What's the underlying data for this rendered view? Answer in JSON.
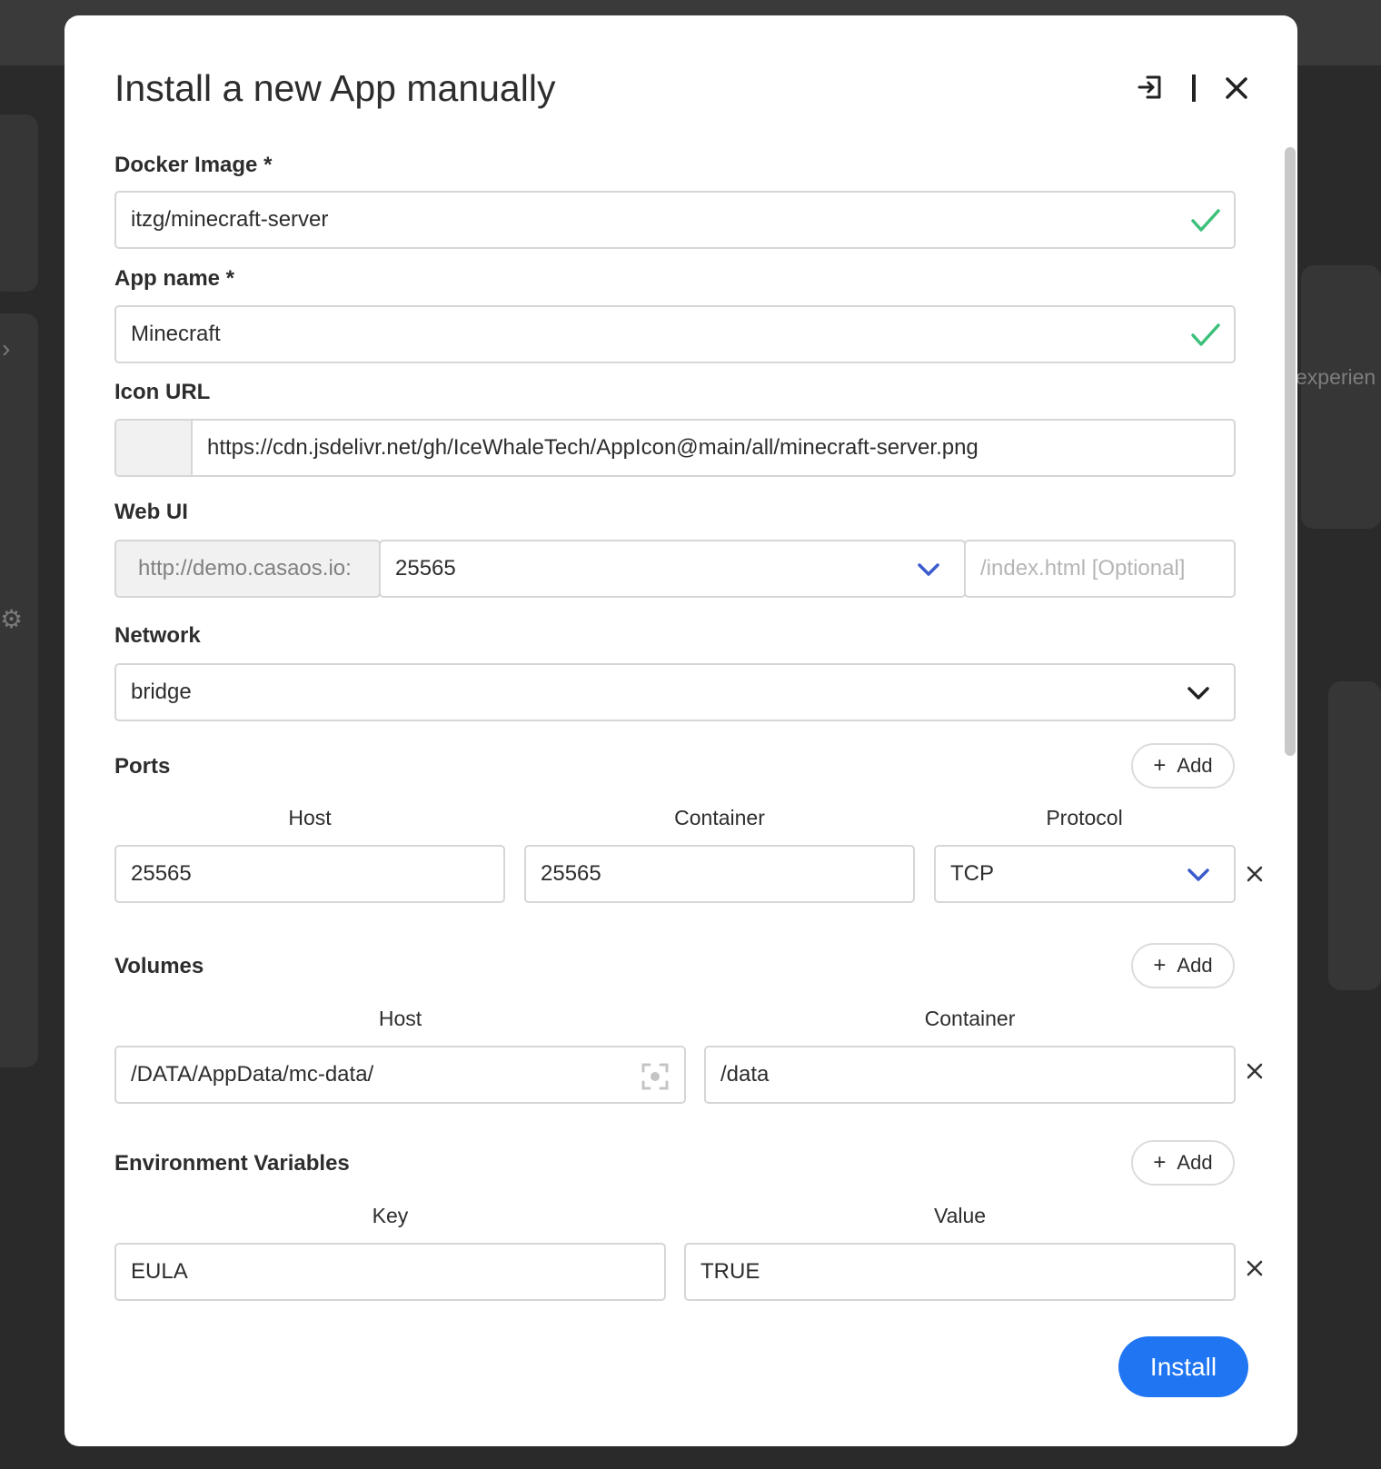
{
  "dialog": {
    "title": "Install a new App manually",
    "icons": {
      "import": "import-icon",
      "close": "close-icon"
    }
  },
  "docker_image": {
    "label": "Docker Image *",
    "value": "itzg/minecraft-server",
    "status_icon": "check-icon"
  },
  "app_name": {
    "label": "App name *",
    "value": "Minecraft",
    "status_icon": "check-icon"
  },
  "icon_url": {
    "label": "Icon URL",
    "value": "https://cdn.jsdelivr.net/gh/IceWhaleTech/AppIcon@main/all/minecraft-server.png"
  },
  "web_ui": {
    "label": "Web UI",
    "host_prefix": "http://demo.casaos.io:",
    "port": "25565",
    "path_placeholder": "/index.html [Optional]"
  },
  "network": {
    "label": "Network",
    "value": "bridge"
  },
  "ports": {
    "label": "Ports",
    "add_label": "Add",
    "columns": {
      "host": "Host",
      "container": "Container",
      "protocol": "Protocol"
    },
    "rows": [
      {
        "host": "25565",
        "container": "25565",
        "protocol": "TCP"
      }
    ]
  },
  "volumes": {
    "label": "Volumes",
    "add_label": "Add",
    "columns": {
      "host": "Host",
      "container": "Container"
    },
    "rows": [
      {
        "host": "/DATA/AppData/mc-data/",
        "container": "/data"
      }
    ]
  },
  "env": {
    "label": "Environment Variables",
    "add_label": "Add",
    "columns": {
      "key": "Key",
      "value": "Value"
    },
    "rows": [
      {
        "key": "EULA",
        "value": "TRUE"
      }
    ]
  },
  "install_label": "Install",
  "background": {
    "partial_text": "experien"
  },
  "colors": {
    "accent": "#1f75f2",
    "check": "#3cc07a",
    "chevron_blue": "#3b5bcc"
  }
}
